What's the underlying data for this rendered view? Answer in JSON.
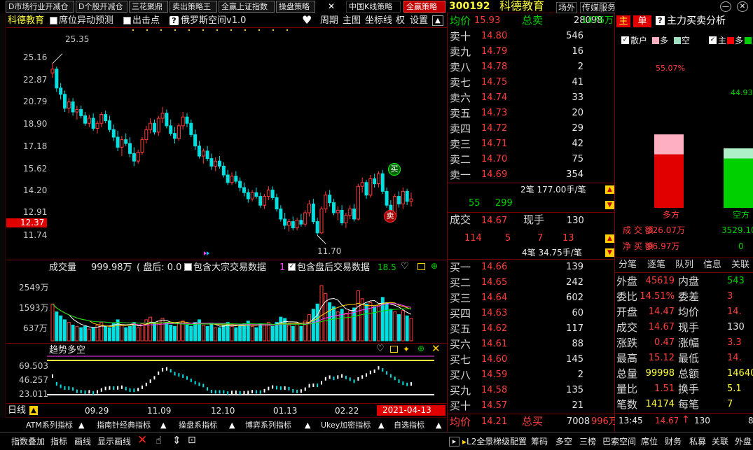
{
  "toolbar": {
    "buttons": [
      "D市场行业开减仓",
      "D个股开减仓",
      "三花聚鼎",
      "卖出策略王",
      "全赢上证指数",
      "操盘策略"
    ],
    "x_label": "✕",
    "china_label": "中国K线策略",
    "strategy_button": "全赢策略"
  },
  "stock": {
    "code": "300192",
    "name": "科德教育",
    "chip1": "场外",
    "chip2": "传媒服务"
  },
  "window_controls": {
    "min": "—",
    "close": "✕"
  },
  "chart_header": {
    "name": "科德教育",
    "chk1": "席位异动预测",
    "chk2": "出击点",
    "chk3": "俄罗斯空间v1.0",
    "menu": [
      "周期",
      "主图",
      "坐标线",
      "权",
      "设置"
    ],
    "up_arrow": "▲"
  },
  "price_axis": {
    "labels": [
      "25.16",
      "22.87",
      "20.79",
      "18.90",
      "17.18",
      "15.62",
      "14.20",
      "12.91",
      "11.74"
    ],
    "current": "12.37",
    "high_mark": "25.35",
    "low_mark": "11.70",
    "buy_label": "买",
    "sell_label": "卖"
  },
  "volume_panel": {
    "title": "成交量",
    "value": "999.98万",
    "after_label": "( 盘后: 0.0",
    "chk_a": "包含大宗交易数据",
    "chk_b": "包含盘后交易数据",
    "extra1": "1",
    "extra2": "18.5",
    "labels": [
      "2549万",
      "1593万",
      "637万"
    ]
  },
  "trend_panel": {
    "title": "趋势多空",
    "labels": [
      "69.503",
      "46.257",
      "23.011"
    ]
  },
  "date_axis": {
    "cycle": "日线",
    "dates": [
      "09.29",
      "11.09",
      "12.10",
      "01.13",
      "02.22"
    ],
    "current_date": "2021-04-13"
  },
  "indicator_tabs": [
    "ATM系列指标",
    "指南针经典指标",
    "操盘系指标",
    "博弈系列指标",
    "Ukey加密指标",
    "自选指标"
  ],
  "bottom_bar": [
    "指数叠加",
    "指标",
    "画线",
    "显示画线"
  ],
  "bottom_right": [
    "L2全景",
    "梯级配置",
    "筹码",
    "多空",
    "三榜",
    "巴索空间",
    "席位",
    "财务",
    "私募",
    "关联",
    "外盘"
  ],
  "orderbook": {
    "avg_label": "均价",
    "avg_value": "15.93",
    "total_sell_label": "总卖",
    "total_sell_value": "28098",
    "total_sell_amount": "1476万",
    "sells": [
      {
        "label": "卖十",
        "price": "14.80",
        "vol": "546"
      },
      {
        "label": "卖九",
        "price": "14.79",
        "vol": "16"
      },
      {
        "label": "卖八",
        "price": "14.78",
        "vol": "2"
      },
      {
        "label": "卖七",
        "price": "14.75",
        "vol": "41"
      },
      {
        "label": "卖六",
        "price": "14.74",
        "vol": "33"
      },
      {
        "label": "卖五",
        "price": "14.73",
        "vol": "20"
      },
      {
        "label": "卖四",
        "price": "14.72",
        "vol": "29"
      },
      {
        "label": "卖三",
        "price": "14.71",
        "vol": "42"
      },
      {
        "label": "卖二",
        "price": "14.70",
        "vol": "75"
      },
      {
        "label": "卖一",
        "price": "14.69",
        "vol": "354"
      }
    ],
    "sell_info": "2笔 177.00手/笔",
    "mid1_a": "55",
    "mid1_b": "299",
    "last_label": "成交",
    "last_price": "14.67",
    "now_label": "现手",
    "now_value": "130",
    "mid2_a": "114",
    "mid2_b": "5",
    "mid2_c": "7",
    "mid2_d": "13",
    "buy_info": "4笔 34.75手/笔",
    "buys": [
      {
        "label": "买一",
        "price": "14.66",
        "vol": "139"
      },
      {
        "label": "买二",
        "price": "14.65",
        "vol": "242"
      },
      {
        "label": "买三",
        "price": "14.64",
        "vol": "602"
      },
      {
        "label": "买四",
        "price": "14.63",
        "vol": "60"
      },
      {
        "label": "买五",
        "price": "14.62",
        "vol": "117"
      },
      {
        "label": "买六",
        "price": "14.61",
        "vol": "88"
      },
      {
        "label": "买七",
        "price": "14.60",
        "vol": "145"
      },
      {
        "label": "买八",
        "price": "14.59",
        "vol": "2"
      },
      {
        "label": "买九",
        "price": "14.58",
        "vol": "135"
      },
      {
        "label": "买十",
        "price": "14.57",
        "vol": "21"
      }
    ],
    "footer_avg_label": "均价",
    "footer_avg_value": "14.21",
    "total_buy_label": "总买",
    "total_buy_value": "7008",
    "total_buy_amount": "996万"
  },
  "analysis": {
    "tab_main": "主",
    "tab_single": "单",
    "title": "主力买卖分析",
    "chk_retail": "散户",
    "chk_retail2": "多",
    "chk_retail3": "空",
    "chk_main": "主",
    "chk_main2": "多",
    "chk_main3": "空",
    "duo_pct": "55.07%",
    "kong_pct": "44.93%",
    "duo_label": "多方",
    "kong_label": "空方",
    "deal_label": "成 交 额",
    "deal_value": "326.07万",
    "deal_value2": "3529.10",
    "net_label": "净 买 额",
    "net_value": "96.97万",
    "net_value2": "0"
  },
  "stats_tabs": [
    "分笔",
    "逐笔",
    "队列",
    "信息",
    "关联"
  ],
  "stats": {
    "waipan_label": "外盘",
    "waipan": "45619",
    "neipan_label": "内盘",
    "neipan": "543",
    "weibi_label": "委比",
    "weibi": "14.51%",
    "weicha_label": "委差",
    "weicha": "3",
    "kaipan_label": "开盘",
    "kaipan": "14.47",
    "junjia_label": "均价",
    "junjia": "14.",
    "chengjiao_label": "成交",
    "chengjiao": "14.67",
    "xianshou_label": "现手",
    "xianshou": "130",
    "zhangdie_label": "涨跌",
    "zhangdie": "0.47",
    "zhangfu_label": "涨幅",
    "zhangfu": "3.3",
    "zuigao_label": "最高",
    "zuigao": "15.12",
    "zuidi_label": "最低",
    "zuidi": "14.",
    "zongliang_label": "总量",
    "zongliang": "99998",
    "zonge_label": "总额",
    "zonge": "14640.",
    "liangbi_label": "量比",
    "liangbi": "1.51",
    "huanshou_label": "换手",
    "huanshou": "5.1",
    "bishu_label": "笔数",
    "bishu": "14174",
    "meibi_label": "每笔",
    "meibi": "7"
  },
  "tick": {
    "time": "13:45",
    "price": "14.67",
    "arrow": "↑",
    "vol": "130",
    "extra": "8"
  },
  "chart_data": {
    "type": "candlestick",
    "ylim": [
      11.0,
      26.0
    ],
    "ohlc": [
      [
        24.6,
        25.35,
        24.2,
        24.9
      ],
      [
        24.9,
        25.1,
        23.1,
        23.4
      ],
      [
        23.4,
        23.8,
        22.5,
        22.9
      ],
      [
        22.9,
        23.2,
        21.5,
        21.8
      ],
      [
        21.8,
        22.6,
        21.4,
        22.3
      ],
      [
        22.3,
        22.6,
        21.2,
        21.5
      ],
      [
        21.5,
        22.0,
        20.9,
        21.7
      ],
      [
        21.7,
        22.0,
        21.0,
        21.2
      ],
      [
        21.2,
        21.5,
        20.4,
        20.6
      ],
      [
        20.6,
        21.3,
        20.3,
        21.0
      ],
      [
        21.0,
        21.4,
        20.0,
        20.2
      ],
      [
        20.2,
        20.8,
        19.8,
        20.6
      ],
      [
        20.6,
        21.5,
        20.3,
        21.3
      ],
      [
        21.3,
        21.6,
        20.6,
        20.8
      ],
      [
        20.8,
        21.2,
        19.9,
        20.1
      ],
      [
        20.1,
        20.5,
        19.2,
        19.5
      ],
      [
        19.5,
        20.0,
        18.4,
        18.7
      ],
      [
        18.7,
        19.6,
        18.0,
        19.3
      ],
      [
        19.3,
        19.8,
        18.8,
        19.0
      ],
      [
        19.0,
        19.5,
        17.9,
        18.2
      ],
      [
        18.2,
        18.7,
        17.2,
        17.6
      ],
      [
        17.6,
        18.5,
        17.4,
        18.3
      ],
      [
        18.3,
        19.5,
        18.1,
        19.3
      ],
      [
        19.3,
        20.4,
        19.0,
        20.1
      ],
      [
        20.1,
        21.0,
        19.8,
        20.6
      ],
      [
        20.6,
        20.9,
        19.7,
        19.9
      ],
      [
        19.9,
        21.2,
        19.6,
        21.0
      ],
      [
        21.0,
        21.9,
        20.6,
        21.4
      ],
      [
        21.4,
        21.7,
        20.2,
        20.4
      ],
      [
        20.4,
        20.9,
        19.6,
        19.8
      ],
      [
        19.8,
        20.3,
        19.0,
        19.4
      ],
      [
        19.4,
        20.6,
        19.2,
        20.4
      ],
      [
        20.4,
        21.5,
        20.1,
        21.1
      ],
      [
        21.1,
        21.4,
        20.3,
        20.6
      ],
      [
        20.6,
        20.9,
        19.5,
        19.7
      ],
      [
        19.7,
        20.1,
        18.5,
        18.8
      ],
      [
        18.8,
        19.2,
        17.8,
        18.0
      ],
      [
        18.0,
        18.6,
        17.4,
        18.4
      ],
      [
        18.4,
        18.8,
        17.6,
        17.8
      ],
      [
        17.8,
        18.2,
        16.9,
        17.2
      ],
      [
        17.2,
        17.9,
        16.8,
        17.6
      ],
      [
        17.6,
        18.0,
        17.0,
        17.2
      ],
      [
        17.2,
        17.5,
        16.3,
        16.5
      ],
      [
        16.5,
        16.9,
        15.7,
        15.9
      ],
      [
        15.9,
        16.7,
        15.7,
        16.4
      ],
      [
        16.4,
        16.8,
        15.8,
        16.0
      ],
      [
        16.0,
        16.3,
        15.2,
        15.5
      ],
      [
        15.5,
        15.9,
        14.8,
        15.1
      ],
      [
        15.1,
        15.4,
        14.3,
        14.6
      ],
      [
        14.6,
        15.3,
        14.4,
        15.1
      ],
      [
        15.1,
        15.5,
        14.6,
        14.8
      ],
      [
        14.8,
        15.1,
        13.9,
        14.1
      ],
      [
        14.1,
        15.0,
        13.8,
        14.8
      ],
      [
        14.8,
        15.6,
        14.5,
        15.3
      ],
      [
        15.3,
        15.6,
        14.5,
        14.7
      ],
      [
        14.7,
        15.0,
        13.6,
        13.8
      ],
      [
        13.8,
        14.1,
        12.8,
        13.0
      ],
      [
        13.0,
        13.5,
        12.2,
        12.5
      ],
      [
        12.5,
        13.0,
        12.0,
        12.8
      ],
      [
        12.8,
        13.2,
        12.1,
        12.3
      ],
      [
        12.3,
        13.1,
        12.1,
        12.9
      ],
      [
        12.9,
        13.4,
        12.4,
        12.6
      ],
      [
        12.6,
        13.7,
        12.4,
        13.5
      ],
      [
        13.5,
        14.5,
        13.2,
        14.2
      ],
      [
        14.2,
        14.6,
        12.6,
        12.8
      ],
      [
        12.8,
        13.1,
        11.7,
        11.9
      ],
      [
        11.9,
        14.0,
        11.8,
        13.8
      ],
      [
        13.8,
        15.2,
        13.5,
        14.9
      ],
      [
        14.9,
        15.3,
        14.0,
        14.3
      ],
      [
        14.3,
        14.6,
        13.3,
        13.5
      ],
      [
        13.5,
        14.0,
        12.9,
        13.7
      ],
      [
        13.7,
        14.1,
        12.5,
        12.7
      ],
      [
        12.7,
        13.5,
        12.3,
        13.3
      ],
      [
        13.3,
        14.1,
        13.0,
        13.8
      ],
      [
        13.8,
        14.2,
        12.8,
        13.0
      ],
      [
        13.0,
        15.8,
        12.9,
        15.6
      ],
      [
        15.6,
        16.3,
        15.1,
        15.9
      ],
      [
        15.9,
        16.1,
        14.6,
        14.9
      ],
      [
        14.9,
        16.5,
        14.7,
        16.2
      ],
      [
        16.2,
        16.6,
        15.5,
        15.8
      ],
      [
        15.8,
        16.8,
        15.5,
        16.6
      ],
      [
        16.6,
        16.9,
        15.0,
        15.2
      ],
      [
        15.2,
        15.5,
        13.9,
        14.1
      ],
      [
        14.1,
        14.5,
        13.0,
        13.3
      ],
      [
        13.3,
        15.0,
        13.1,
        14.8
      ],
      [
        14.8,
        15.2,
        13.9,
        14.2
      ],
      [
        14.2,
        15.5,
        13.8,
        15.2
      ],
      [
        15.2,
        15.4,
        14.1,
        14.4
      ],
      [
        14.4,
        15.1,
        14.0,
        14.6
      ]
    ],
    "volume": [
      2.8,
      2.2,
      1.9,
      1.6,
      1.4,
      1.2,
      1.1,
      1.0,
      1.1,
      0.9,
      1.0,
      1.2,
      1.4,
      1.1,
      1.0,
      1.3,
      1.6,
      1.2,
      1.0,
      1.1,
      1.4,
      1.0,
      1.3,
      1.6,
      1.8,
      1.3,
      1.5,
      1.7,
      1.4,
      1.2,
      1.1,
      1.3,
      1.5,
      1.2,
      1.1,
      1.4,
      1.6,
      1.2,
      1.1,
      1.3,
      1.0,
      1.0,
      1.2,
      1.4,
      1.1,
      1.0,
      1.2,
      1.3,
      1.5,
      1.1,
      1.0,
      1.3,
      1.2,
      1.4,
      1.1,
      1.4,
      1.8,
      1.7,
      1.2,
      1.1,
      1.3,
      1.1,
      1.5,
      2.0,
      2.4,
      2.8,
      4.2,
      3.6,
      2.9,
      2.6,
      2.2,
      2.4,
      2.1,
      2.3,
      2.5,
      3.8,
      3.2,
      2.8,
      2.9,
      2.6,
      2.7,
      3.3,
      2.9,
      2.4,
      2.2,
      2.0,
      2.3,
      1.9,
      1.7
    ],
    "volume_ylim": [
      0,
      5
    ]
  }
}
